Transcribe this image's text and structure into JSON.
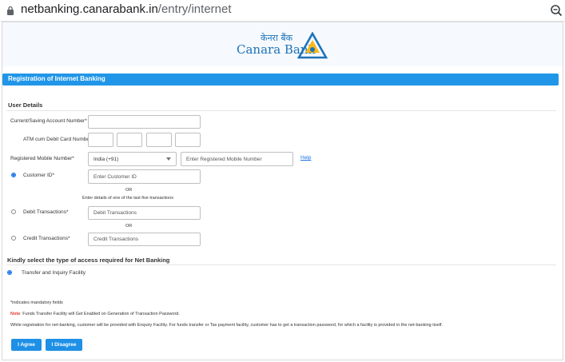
{
  "browser": {
    "url_host": "netbanking.canarabank.in",
    "url_path": "/entry/internet"
  },
  "header": {
    "brand_hindi": "केनरा बैंक",
    "brand_english": "Canara Bank"
  },
  "page": {
    "title": "Registration of Internet Banking"
  },
  "user_details": {
    "heading": "User Details",
    "account_label": "Current/Saving Account Number*",
    "account_value": "",
    "atm_label": "ATM cum Debit Card Number*",
    "mobile_label": "Registered Mobile Number*",
    "country_code": "India (+91)",
    "mobile_placeholder": "Enter Registered Mobile Number",
    "help_link": "Help",
    "customer_id_label": "Customer ID*",
    "customer_id_placeholder": "Enter Customer ID",
    "or_1": "OR",
    "transactions_note": "Enter details of one of the last five transactions",
    "debit_label": "Debit Transactions*",
    "debit_placeholder": "Debit Transactions",
    "or_2": "OR",
    "credit_label": "Credit Transactions*",
    "credit_placeholder": "Credit Transactions"
  },
  "access": {
    "heading": "Kindly select the type of access required for Net Banking",
    "option_label": "Transfer and Inquiry Facility"
  },
  "footer": {
    "mandatory": "*indicates mandatory fields",
    "note_label": "Note",
    "note_text": ": Funds Transfer Facility will Get Enabled on Generation of Transaction Password.",
    "info_text": "While registration for net-banking, customer will be provided with Enquiry Facility. For funds transfer or Tax payment facility, customer has to get a transaction password, for which a facility is provided in the net-banking itself.",
    "agree_button": "I Agree",
    "disagree_button": "I Disagree"
  },
  "colors": {
    "accent_blue": "#2196e8",
    "brand_blue": "#1c73b9",
    "brand_yellow": "#f6b81a",
    "note_red": "#e53935"
  }
}
